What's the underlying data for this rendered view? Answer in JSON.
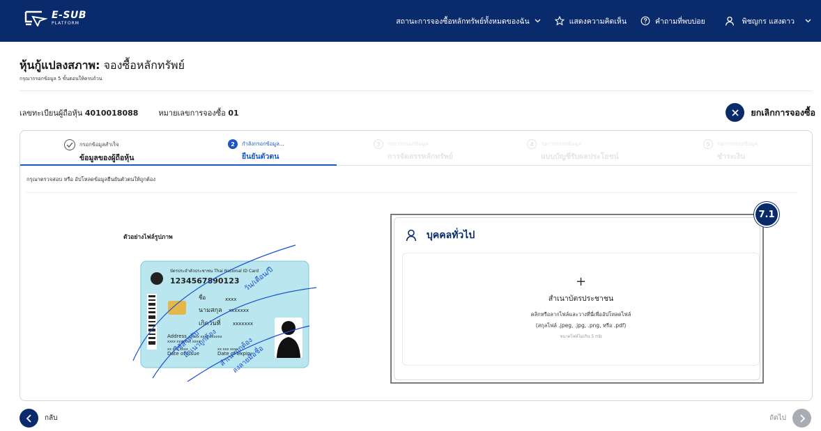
{
  "header": {
    "logo_main": "E-SUB",
    "logo_sub": "PLATFORM",
    "nav_subscriptions": "สถานะการจองซื้อหลักทรัพย์ทั้งหมดของฉัน",
    "nav_feedback": "แสดงความคิดเห็น",
    "nav_faq": "คำถามที่พบบ่อย",
    "nav_user": "พิชญกร แสงดาว"
  },
  "page": {
    "title_bold": "หุ้นกู้แปลงสภาพ:",
    "title_rest": " จองซื้อหลักทรัพย์",
    "subtitle": "กรุณากรอกข้อมูล 5 ขั้นตอนให้ครบถ้วน"
  },
  "registration": {
    "label": "เลขทะเบียนผู้ถือหุ้น",
    "value": "4010018088",
    "sub_label": "หมายเลขการจองซื้อ",
    "sub_value": "01"
  },
  "cancel": {
    "label": "ยกเลิกการจองซื้อ"
  },
  "steps": [
    {
      "number": "✓",
      "status": "กรอกข้อมูลสำเร็จ",
      "title": "ข้อมูลของผู้ถือหุ้น"
    },
    {
      "number": "2",
      "status": "กำลังกรอกข้อมูล...",
      "title": "ยืนยันตัวตน"
    },
    {
      "number": "3",
      "status": "รอการกรอกข้อมูล",
      "title": "การจัดสรรหลักทรัพย์"
    },
    {
      "number": "4",
      "status": "รอการกรอกข้อมูล",
      "title": "แบบบัญชีรับผลประโยชน์"
    },
    {
      "number": "5",
      "status": "รอการกรอกข้อมูล",
      "title": "ชำระเงิน"
    }
  ],
  "instruction": "กรุณาตรวจสอบ หรือ อัปโหลดข้อมูลยืนยันตัวตนให้ถูกต้อง",
  "sample": {
    "label": "ตัวอย่างไฟล์รูปภาพ",
    "card_header": "บัตรประจำตัวประชาชน Thai National ID Card",
    "card_number": "1234567890123",
    "name_label": "ชื่อ",
    "name_value": "xxxx",
    "surname_label": "นามสกุล",
    "surname_value": "xxxxxxx",
    "birth_label": "เกิดวันที่",
    "birth_value": "xxxxxxx",
    "address_label": "Address",
    "address_value": "xxxxx xxxx xxxxxx",
    "address_value2": "xxxx xxxxxxx xxxx",
    "issue_value": "xx xxx xxxx",
    "issue_label": "Date of Issue",
    "expiry_value": "xx xxx xxxx",
    "expiry_label": "Date of Expiry",
    "sig_top": "วัน/เดือน/ปี",
    "sig_mid1": "ใช้สำหรับ",
    "sig_mid2": "สำเนาถูกต้อง",
    "sig_low1": "สำเนาถูกต้อง",
    "sig_low2": "ลงลายมือชื่อ"
  },
  "upload": {
    "badge": "7.1",
    "section_title": "บุคคลทั่วไป",
    "plus": "+",
    "title": "สำเนาบัตรประชาชน",
    "line1": "คลิกหรือลากไฟล์และวางที่นี่เพื่ออัปโหลดไฟล์",
    "line2": "(สกุลไฟล์ .jpeg, .jpg, .png, หรือ .pdf)",
    "line3": "ขนาดไฟล์ไม่เกิน 5 mb"
  },
  "footer": {
    "back": "กลับ",
    "next": "ถัดไป"
  },
  "colors": {
    "navy": "#0a2b6b",
    "active_blue": "#1a56c4",
    "card_cyan": "#b9e6ef"
  }
}
